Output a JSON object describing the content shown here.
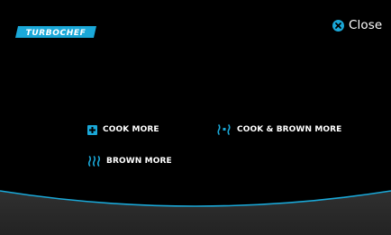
{
  "brand": {
    "logo_text": "TURBOCHEF",
    "logo_color": "#1aa8d8"
  },
  "header": {
    "close_label": "Close",
    "close_icon": "close-circle-icon"
  },
  "options": {
    "cook_more": {
      "label": "COOK MORE",
      "icon": "plus-square-icon"
    },
    "cook_and_brown_more": {
      "label": "COOK & BROWN MORE",
      "icon": "cook-brown-icon"
    },
    "brown_more": {
      "label": "BROWN MORE",
      "icon": "heat-waves-icon"
    }
  },
  "colors": {
    "accent": "#1aa8d8",
    "background": "#000000",
    "bottom_band": "#2b2b2b",
    "text": "#ffffff"
  }
}
